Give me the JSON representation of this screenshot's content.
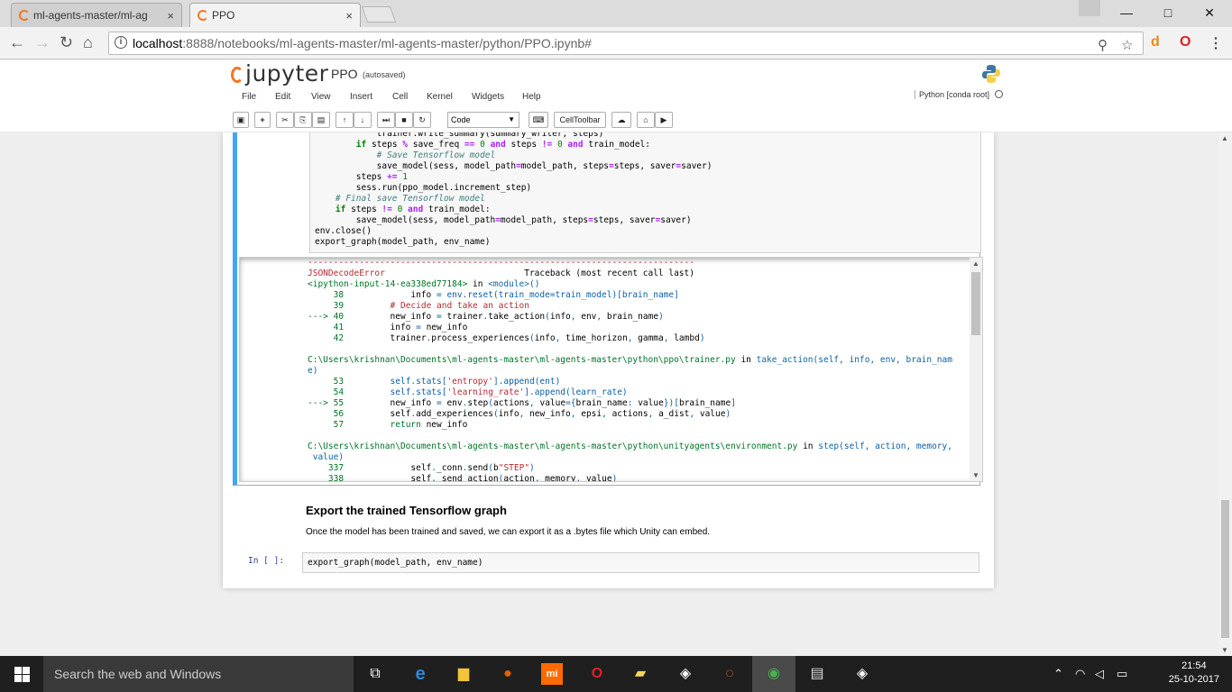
{
  "browser": {
    "tabs": [
      {
        "title": "ml-agents-master/ml-ag",
        "close": "×"
      },
      {
        "title": "PPO",
        "close": "×"
      }
    ],
    "url_host": "localhost",
    "url_path": ":8888/notebooks/ml-agents-master/ml-agents-master/python/PPO.ipynb#",
    "window_controls": [
      "—",
      "□",
      "✕"
    ]
  },
  "jupyter": {
    "logo_text": "jupyter",
    "notebook_name": "PPO",
    "autosave_status": "(autosaved)",
    "menu": [
      "File",
      "Edit",
      "View",
      "Insert",
      "Cell",
      "Kernel",
      "Widgets",
      "Help"
    ],
    "kernel_name": "Python [conda root]",
    "cell_type": "Code",
    "celltoolbar_label": "CellToolbar"
  },
  "notebook": {
    "markdown_heading": "Export the trained Tensorflow graph",
    "markdown_text": "Once the model has been trained and saved, we can export it as a .bytes file which Unity can embed.",
    "next_prompt": "In [ ]:",
    "next_code": "export_graph(model_path, env_name)"
  },
  "taskbar": {
    "search_placeholder": "Search the web and Windows",
    "time": "21:54",
    "date": "25-10-2017"
  },
  "colors": {
    "selected_cell_border": "#42a5f5",
    "jupyter_orange": "#f37726",
    "prompt_blue": "#303f9f",
    "error_red": "#b22b31"
  }
}
